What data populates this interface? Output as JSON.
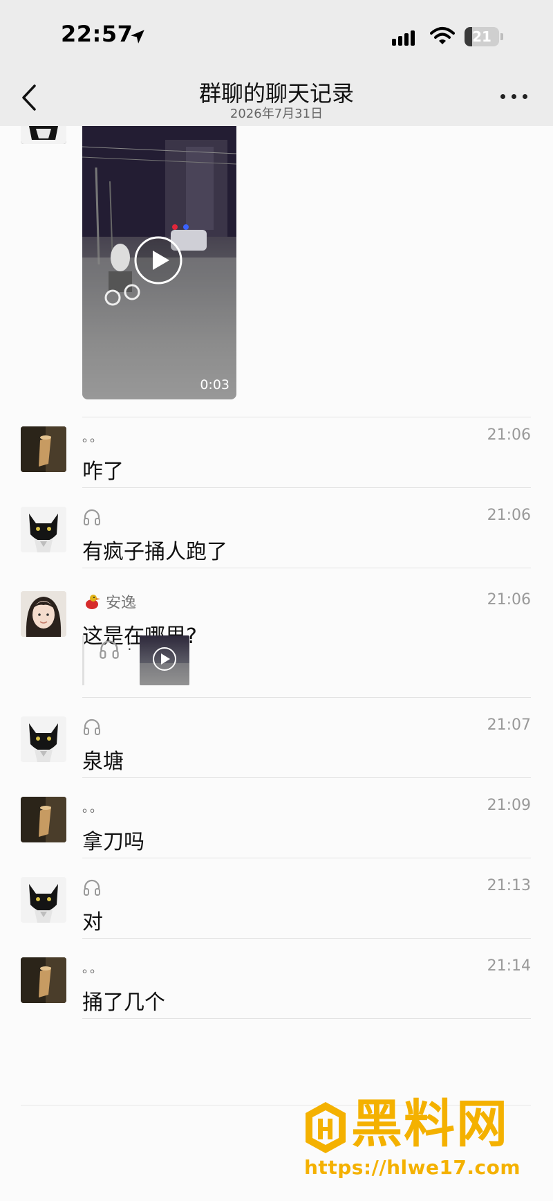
{
  "status_bar": {
    "time": "22:57",
    "battery": "21",
    "battery_level": 0.21
  },
  "header": {
    "title": "群聊的聊天记录",
    "subtitle": "2026年7月31日"
  },
  "video": {
    "duration": "0:03"
  },
  "messages": [
    {
      "sender": "。。",
      "sender_type": "dots",
      "avatar": "cup",
      "time": "21:06",
      "text": "咋了"
    },
    {
      "sender": "",
      "sender_type": "headphones-icon",
      "avatar": "cat",
      "time": "21:06",
      "text": "有疯子捅人跑了"
    },
    {
      "sender": "安逸",
      "sender_type": "name",
      "avatar": "girl",
      "time": "21:06",
      "text": "这是在哪里?",
      "quote": {
        "colon": ":"
      }
    },
    {
      "sender": "",
      "sender_type": "headphones-icon",
      "avatar": "cat",
      "time": "21:07",
      "text": "泉塘"
    },
    {
      "sender": "。。",
      "sender_type": "dots",
      "avatar": "cup",
      "time": "21:09",
      "text": "拿刀吗"
    },
    {
      "sender": "",
      "sender_type": "headphones-icon",
      "avatar": "cat",
      "time": "21:13",
      "text": "对"
    },
    {
      "sender": "。。",
      "sender_type": "dots",
      "avatar": "cup",
      "time": "21:14",
      "text": "捅了几个"
    }
  ],
  "watermark": {
    "title": "黑料网",
    "url": "https://hlwe17.com"
  },
  "colors": {
    "header_bg": "#ececec",
    "watermark": "#f4b100",
    "timestamp": "#999999"
  }
}
